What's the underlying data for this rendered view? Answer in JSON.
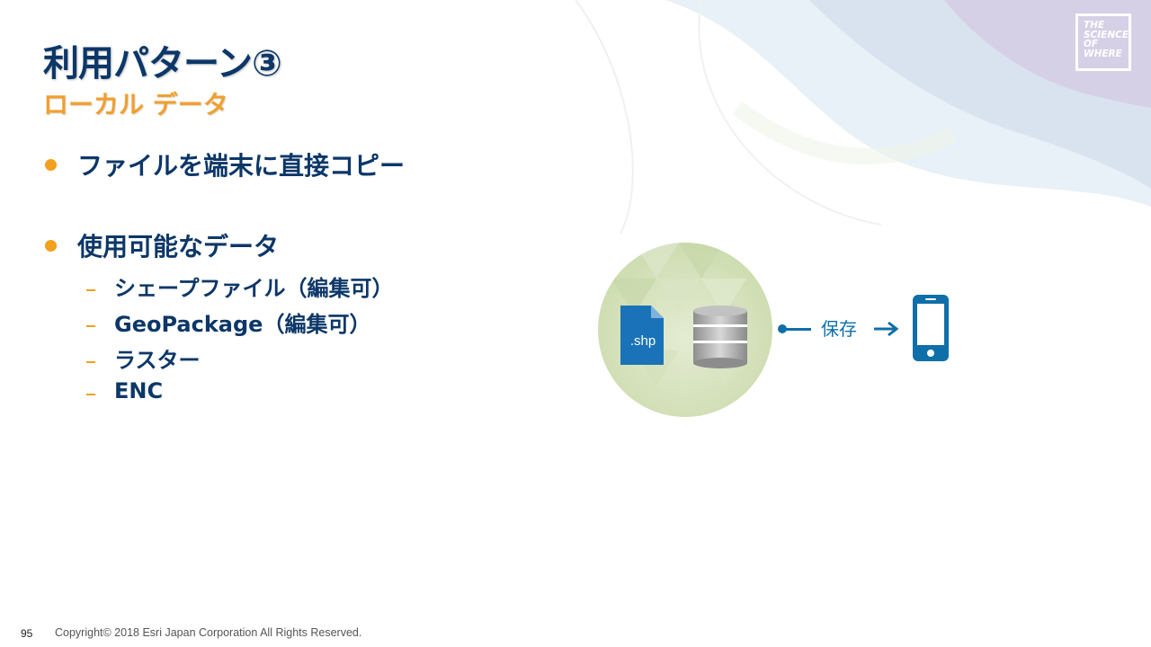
{
  "slide": {
    "title": "利用パターン③",
    "subtitle": "ローカル データ",
    "bullets": [
      {
        "text": "ファイルを端末に直接コピー"
      },
      {
        "text": "使用可能なデータ"
      }
    ],
    "sub_items": [
      "シェープファイル（編集可）",
      "GeoPackage（編集可）",
      "ラスター",
      "ENC"
    ],
    "diagram": {
      "file_label": ".shp",
      "save_label": "保存"
    },
    "logo_lines": [
      "THE",
      "SCIENCE",
      "OF",
      "WHERE"
    ],
    "page_number": "95",
    "copyright": "Copyright© 2018 Esri Japan Corporation All Rights Reserved."
  },
  "colors": {
    "title": "#0c3768",
    "accent": "#f2a01e",
    "diagram_blue": "#0f6fa8"
  }
}
